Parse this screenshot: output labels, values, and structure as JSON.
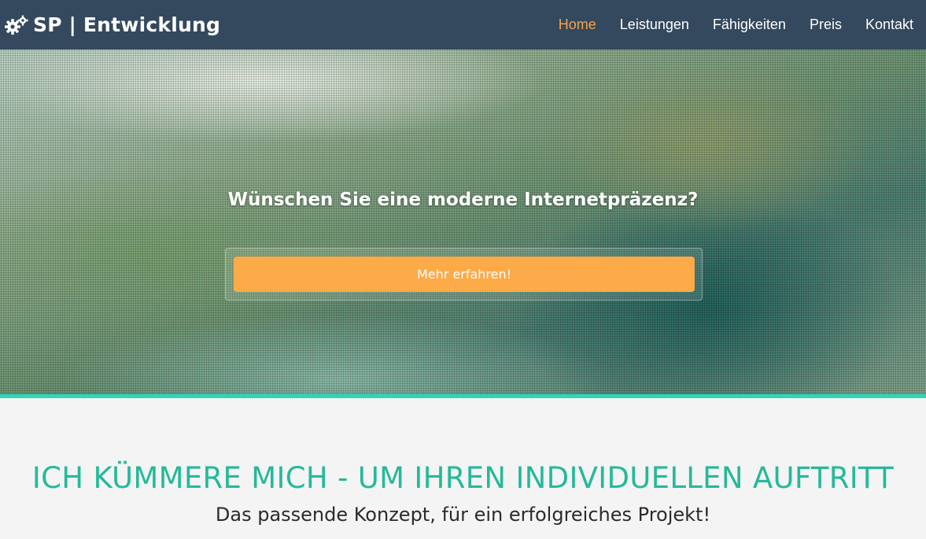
{
  "navbar": {
    "brand_icon": "gears-icon",
    "brand_text": "SP | Entwicklung",
    "links": [
      {
        "label": "Home",
        "active": true
      },
      {
        "label": "Leistungen",
        "active": false
      },
      {
        "label": "Fähigkeiten",
        "active": false
      },
      {
        "label": "Preis",
        "active": false
      },
      {
        "label": "Kontakt",
        "active": false
      }
    ],
    "active_color": "#f6a445",
    "background": "#34495e"
  },
  "hero": {
    "title": "Wünschen Sie eine moderne Internetpräzenz?",
    "cta_label": "Mehr erfahren!",
    "cta_color": "#fdaa48",
    "border_color": "#2ed6b8"
  },
  "intro": {
    "heading": "ICH KÜMMERE MICH - UM IHREN INDIVIDUELLEN AUFTRITT",
    "subheading": "Das passende Konzept, für ein erfolgreiches Projekt!",
    "heading_color": "#25b99a"
  }
}
